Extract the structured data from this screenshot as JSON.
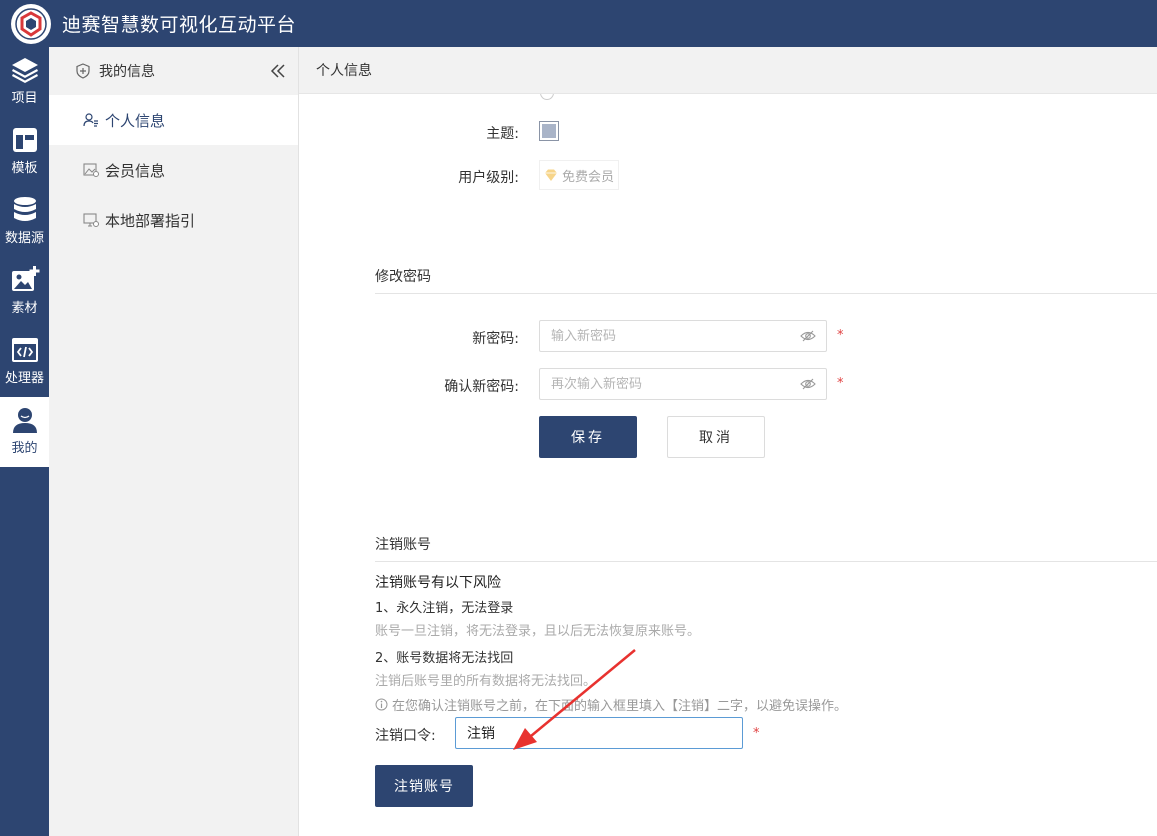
{
  "app": {
    "title": "迪赛智慧数可视化互动平台",
    "brand_color": "#2d4571"
  },
  "rail": {
    "items": [
      {
        "label": "项目",
        "icon": "layers-icon"
      },
      {
        "label": "模板",
        "icon": "template-icon"
      },
      {
        "label": "数据源",
        "icon": "database-icon"
      },
      {
        "label": "素材",
        "icon": "image-add-icon"
      },
      {
        "label": "处理器",
        "icon": "code-window-icon"
      },
      {
        "label": "我的",
        "icon": "user-icon",
        "active": true
      }
    ]
  },
  "sidebar": {
    "header": "我的信息",
    "items": [
      {
        "label": "个人信息",
        "icon": "user-card-icon",
        "active": true
      },
      {
        "label": "会员信息",
        "icon": "picture-card-icon"
      },
      {
        "label": "本地部署指引",
        "icon": "monitor-icon"
      }
    ]
  },
  "main": {
    "breadcrumb": "个人信息",
    "profile": {
      "theme_label": "主题:",
      "theme_color": "#a9b4c8",
      "level_label": "用户级别:",
      "level_value": "免费会员"
    },
    "password": {
      "title": "修改密码",
      "new_label": "新密码:",
      "new_placeholder": "输入新密码",
      "confirm_label": "确认新密码:",
      "confirm_placeholder": "再次输入新密码",
      "required_mark": "*",
      "save_label": "保存",
      "cancel_label": "取消"
    },
    "deactivate": {
      "title": "注销账号",
      "risk_title": "注销账号有以下风险",
      "risk1_title": "1、永久注销，无法登录",
      "risk1_desc": "账号一旦注销，将无法登录，且以后无法恢复原来账号。",
      "risk2_title": "2、账号数据将无法找回",
      "risk2_desc": "注销后账号里的所有数据将无法找回。",
      "hint": "在您确认注销账号之前，在下面的输入框里填入【注销】二字，以避免误操作。",
      "code_label": "注销口令:",
      "code_value": "注销",
      "required_mark": "*",
      "button_label": "注销账号"
    }
  }
}
